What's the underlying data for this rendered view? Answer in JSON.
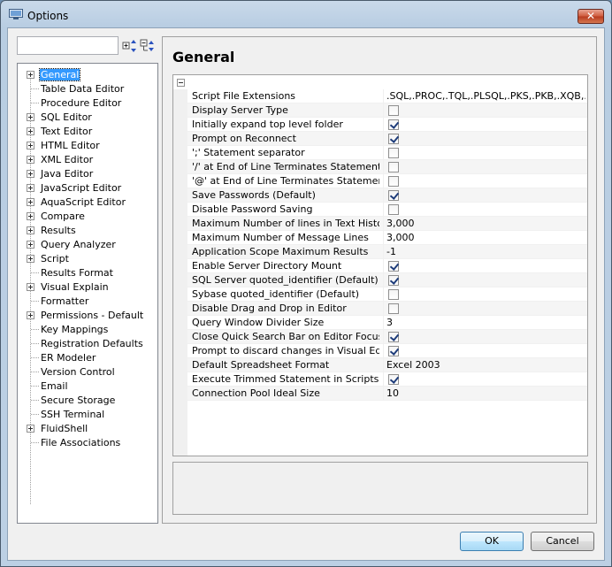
{
  "window": {
    "title": "Options",
    "close_label": "✕"
  },
  "search": {
    "value": "",
    "placeholder": ""
  },
  "tree": {
    "items": [
      {
        "label": "General",
        "expandable": true,
        "selected": true
      },
      {
        "label": "Table Data Editor",
        "expandable": false
      },
      {
        "label": "Procedure Editor",
        "expandable": false
      },
      {
        "label": "SQL Editor",
        "expandable": true
      },
      {
        "label": "Text Editor",
        "expandable": true
      },
      {
        "label": "HTML Editor",
        "expandable": true
      },
      {
        "label": "XML Editor",
        "expandable": true
      },
      {
        "label": "Java Editor",
        "expandable": true
      },
      {
        "label": "JavaScript Editor",
        "expandable": true
      },
      {
        "label": "AquaScript Editor",
        "expandable": true
      },
      {
        "label": "Compare",
        "expandable": true
      },
      {
        "label": "Results",
        "expandable": true
      },
      {
        "label": "Query Analyzer",
        "expandable": true
      },
      {
        "label": "Script",
        "expandable": true
      },
      {
        "label": "Results Format",
        "expandable": false
      },
      {
        "label": "Visual Explain",
        "expandable": true
      },
      {
        "label": "Formatter",
        "expandable": false
      },
      {
        "label": "Permissions - Default",
        "expandable": true
      },
      {
        "label": "Key Mappings",
        "expandable": false
      },
      {
        "label": "Registration Defaults",
        "expandable": false
      },
      {
        "label": "ER Modeler",
        "expandable": false
      },
      {
        "label": "Version Control",
        "expandable": false
      },
      {
        "label": "Email",
        "expandable": false
      },
      {
        "label": "Secure Storage",
        "expandable": false
      },
      {
        "label": "SSH Terminal",
        "expandable": false
      },
      {
        "label": "FluidShell",
        "expandable": true
      },
      {
        "label": "File Associations",
        "expandable": false
      }
    ]
  },
  "panel": {
    "title": "General",
    "properties": [
      {
        "name": "Script File Extensions",
        "type": "text",
        "value": ".SQL,.PROC,.TQL,.PLSQL,.PKS,.PKB,.XQB,.T..."
      },
      {
        "name": "Display Server Type",
        "type": "check",
        "checked": false
      },
      {
        "name": "Initially expand top level folder",
        "type": "check",
        "checked": true
      },
      {
        "name": "Prompt on Reconnect",
        "type": "check",
        "checked": true
      },
      {
        "name": "';' Statement separator",
        "type": "check",
        "checked": false
      },
      {
        "name": "'/' at End of Line Terminates Statement",
        "type": "check",
        "checked": false
      },
      {
        "name": "'@' at End of Line Terminates Statement",
        "type": "check",
        "checked": false
      },
      {
        "name": "Save Passwords (Default)",
        "type": "check",
        "checked": true
      },
      {
        "name": "Disable Password Saving",
        "type": "check",
        "checked": false
      },
      {
        "name": "Maximum Number of lines in Text History",
        "type": "text",
        "value": "3,000"
      },
      {
        "name": "Maximum Number of Message Lines",
        "type": "text",
        "value": "3,000"
      },
      {
        "name": "Application Scope Maximum Results",
        "type": "text",
        "value": "-1"
      },
      {
        "name": "Enable Server Directory Mount",
        "type": "check",
        "checked": true
      },
      {
        "name": "SQL Server quoted_identifier (Default)",
        "type": "check",
        "checked": true
      },
      {
        "name": "Sybase quoted_identifier (Default)",
        "type": "check",
        "checked": false
      },
      {
        "name": "Disable Drag and Drop in Editor",
        "type": "check",
        "checked": false
      },
      {
        "name": "Query Window Divider Size",
        "type": "text",
        "value": "3"
      },
      {
        "name": "Close Quick Search Bar on Editor Focus",
        "type": "check",
        "checked": true
      },
      {
        "name": "Prompt to discard changes in Visual Editin...",
        "type": "check",
        "checked": true
      },
      {
        "name": "Default Spreadsheet Format",
        "type": "text",
        "value": "Excel 2003"
      },
      {
        "name": "Execute Trimmed Statement in Scripts",
        "type": "check",
        "checked": true
      },
      {
        "name": "Connection Pool Ideal Size",
        "type": "text",
        "value": "10"
      }
    ]
  },
  "buttons": {
    "ok_label": "OK",
    "cancel_label": "Cancel"
  },
  "colors": {
    "selection": "#3399ff",
    "check": "#1e3c7a"
  }
}
